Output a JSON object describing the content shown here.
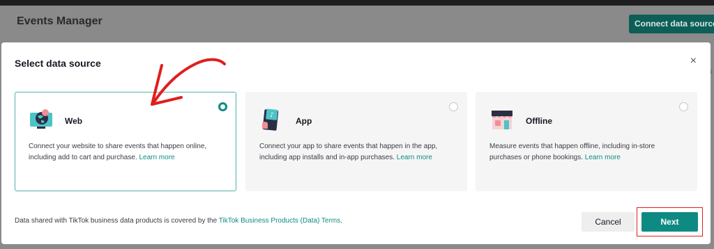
{
  "background": {
    "title": "Events Manager",
    "connect_button": "Connect data source",
    "side_close": "×"
  },
  "modal": {
    "title": "Select data source",
    "close": "×",
    "options": [
      {
        "name": "Web",
        "icon": "web-globe-icon",
        "description": "Connect your website to share events that happen online, including add to cart and purchase.",
        "link": "Learn more",
        "selected": true
      },
      {
        "name": "App",
        "icon": "phone-tiktok-icon",
        "description": "Connect your app to share events that happen in the app, including app installs and in-app purchases.",
        "link": "Learn more",
        "selected": false
      },
      {
        "name": "Offline",
        "icon": "store-icon",
        "description": "Measure events that happen offline, including in-store purchases or phone bookings.",
        "link": "Learn more",
        "selected": false
      }
    ],
    "footer": {
      "text": "Data shared with TikTok business data products is covered by the",
      "link": "TikTok Business Products (Data) Terms",
      "suffix": "."
    },
    "buttons": {
      "cancel": "Cancel",
      "next": "Next"
    }
  },
  "colors": {
    "accent": "#0f8a83",
    "annotation": "#e01e1e"
  }
}
